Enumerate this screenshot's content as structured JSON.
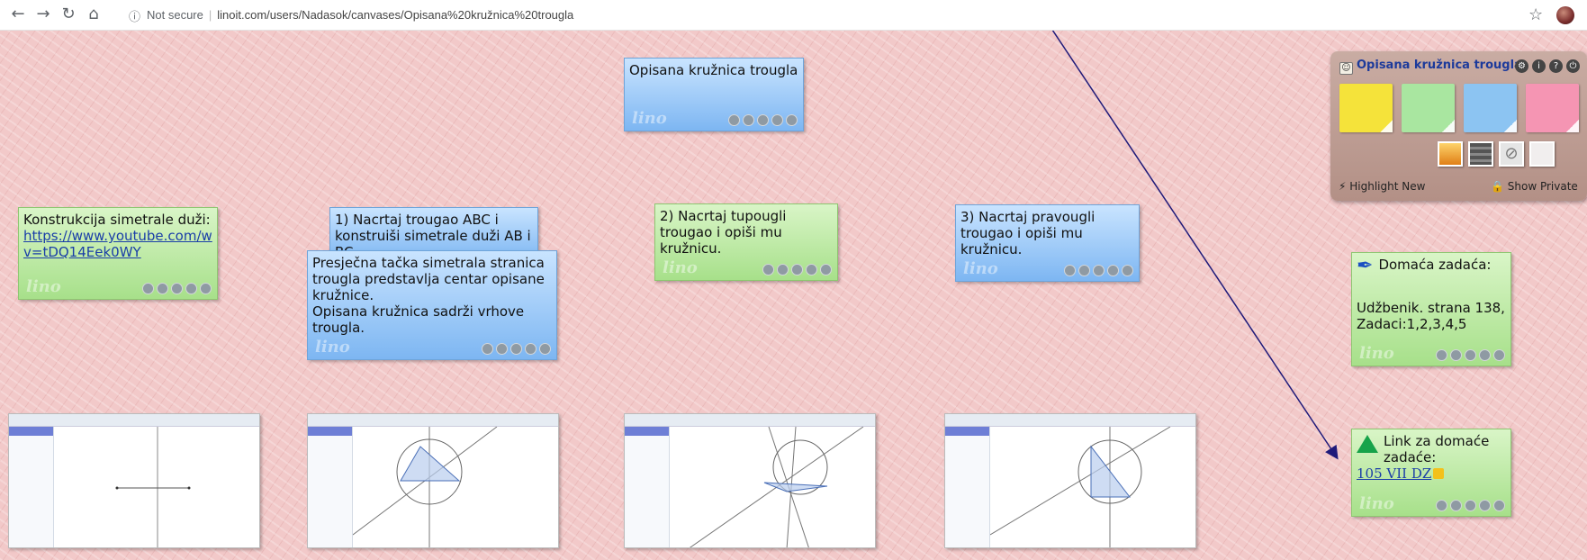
{
  "browser": {
    "security_label": "Not secure",
    "url": "linoit.com/users/Nadasok/canvases/Opisana%20kružnica%20trougla"
  },
  "canvas": {
    "title_note": "Opisana kružnica trougla",
    "notes": {
      "construction_text": "Konstrukcija simetrale duži:",
      "construction_link": "https://www.youtube.com/watch?v=tDQ14Eek0WY",
      "construction_link_display": "https://www.youtube.com/w\nv=tDQ14Eek0WY",
      "task1": "1) Nacrtaj trougao ABC i konstruiši simetrale duži AB i BC.",
      "theory": "Presječna tačka simetrala stranica trougla predstavlja centar opisane kružnice.\nOpisana kružnica sadrži vrhove trougla.",
      "task2": "2) Nacrtaj tupougli trougao i opiši mu kružnicu.",
      "task3": "3) Nacrtaj pravougli trougao i opiši mu kružnicu.",
      "homework_title": "Domaća zadaća:",
      "homework_body": "Udžbenik. strana 138,\nZadaci:1,2,3,4,5",
      "link_title": "Link za domaće zadaće:",
      "link_value": "105 VII DZ"
    },
    "watermark": "lino"
  },
  "panel": {
    "title": "Opisana kružnica trougla",
    "highlight_new": "Highlight New",
    "show_private": "Show Private",
    "colors": {
      "yellow": "#f5e33a",
      "green": "#a9e6a0",
      "blue": "#8cc4f2",
      "pink": "#f595b3"
    }
  }
}
